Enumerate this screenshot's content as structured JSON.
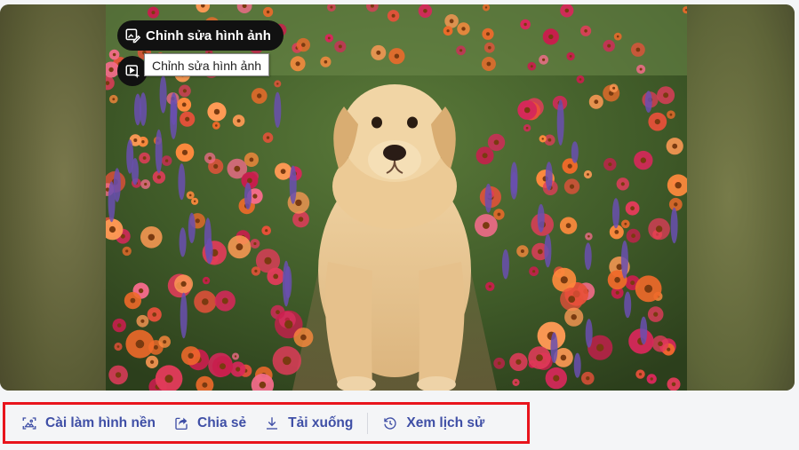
{
  "overlay": {
    "edit_button_label": "Chỉnh sửa hình ảnh",
    "tooltip_text": "Chỉnh sửa hình ảnh"
  },
  "toolbar": {
    "set_wallpaper_label": "Cài làm hình nền",
    "share_label": "Chia sẻ",
    "download_label": "Tải xuống",
    "history_label": "Xem lịch sử"
  },
  "colors": {
    "action_text": "#3f4fa6",
    "highlight_border": "#e8141c",
    "overlay_bg": "#111111"
  },
  "icons": {
    "edit": "image-edit-icon",
    "video": "video-sparkle-icon",
    "wallpaper": "wallpaper-icon",
    "share": "share-icon",
    "download": "download-icon",
    "history": "history-icon"
  }
}
